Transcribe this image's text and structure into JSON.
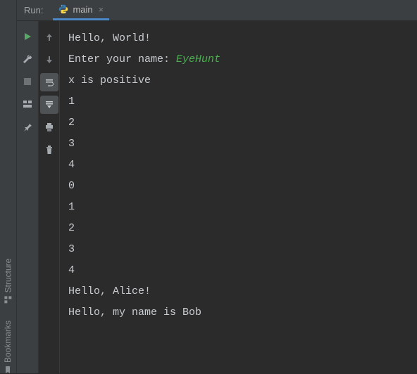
{
  "gutter": {
    "structure": "Structure",
    "bookmarks": "Bookmarks"
  },
  "tabbar": {
    "run_label": "Run:",
    "tab_name": "main",
    "close_glyph": "×"
  },
  "console": {
    "prompt_prefix": "Enter your name: ",
    "user_input": "EyeHunt",
    "lines_before": [
      "Hello, World!"
    ],
    "lines_after": [
      "x is positive",
      "1",
      "2",
      "3",
      "4",
      "0",
      "1",
      "2",
      "3",
      "4",
      "Hello, Alice!",
      "Hello, my name is Bob"
    ]
  }
}
